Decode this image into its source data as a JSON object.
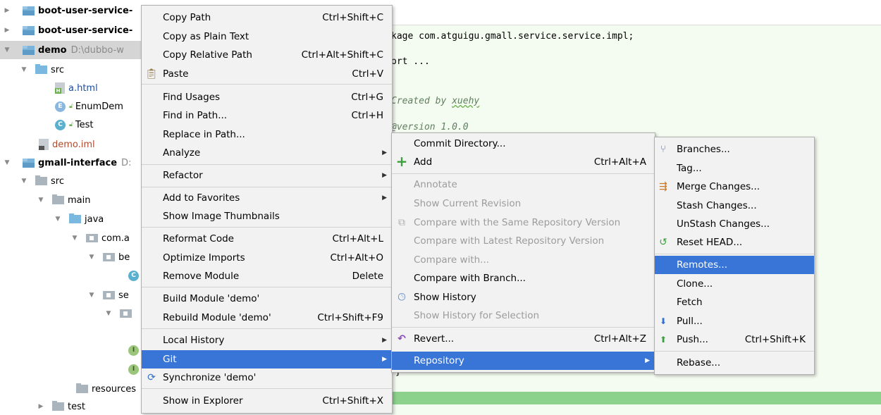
{
  "tree": {
    "items": [
      {
        "label": "boot-user-service-",
        "path": ""
      },
      {
        "label": "boot-user-service-",
        "path": ""
      },
      {
        "label": "demo",
        "path": "D:\\dubbo-w"
      },
      {
        "label": "src"
      },
      {
        "label": "a.html"
      },
      {
        "label": "EnumDem"
      },
      {
        "label": "Test"
      },
      {
        "label": "demo.iml"
      },
      {
        "label": "gmall-interface",
        "path": "D:"
      },
      {
        "label": "src"
      },
      {
        "label": "main"
      },
      {
        "label": "java"
      },
      {
        "label": "com.a"
      },
      {
        "label": "be"
      },
      {
        "label": "se"
      },
      {
        "label": "resources"
      },
      {
        "label": "test"
      }
    ],
    "icon_letters": {
      "enum": "E",
      "class": "C",
      "interface": "I"
    }
  },
  "editor": {
    "lines": [
      "kage com.atguigu.gmall.service.service.impl;",
      "ort ...",
      "Created by ",
      "xuehy",
      "@version 1.0.0",
      "}"
    ]
  },
  "context_menu": {
    "items": [
      {
        "label": "Copy Path",
        "shortcut": "Ctrl+Shift+C"
      },
      {
        "label": "Copy as Plain Text",
        "shortcut": ""
      },
      {
        "label": "Copy Relative Path",
        "shortcut": "Ctrl+Alt+Shift+C"
      },
      {
        "label": "Paste",
        "shortcut": "Ctrl+V"
      },
      {
        "label": "Find Usages",
        "shortcut": "Ctrl+G"
      },
      {
        "label": "Find in Path...",
        "shortcut": "Ctrl+H"
      },
      {
        "label": "Replace in Path...",
        "shortcut": ""
      },
      {
        "label": "Analyze",
        "shortcut": ""
      },
      {
        "label": "Refactor",
        "shortcut": ""
      },
      {
        "label": "Add to Favorites",
        "shortcut": ""
      },
      {
        "label": "Show Image Thumbnails",
        "shortcut": ""
      },
      {
        "label": "Reformat Code",
        "shortcut": "Ctrl+Alt+L"
      },
      {
        "label": "Optimize Imports",
        "shortcut": "Ctrl+Alt+O"
      },
      {
        "label": "Remove Module",
        "shortcut": "Delete"
      },
      {
        "label": "Build Module 'demo'",
        "shortcut": ""
      },
      {
        "label": "Rebuild Module 'demo'",
        "shortcut": "Ctrl+Shift+F9"
      },
      {
        "label": "Local History",
        "shortcut": ""
      },
      {
        "label": "Git",
        "shortcut": ""
      },
      {
        "label": "Synchronize 'demo'",
        "shortcut": ""
      },
      {
        "label": "Show in Explorer",
        "shortcut": "Ctrl+Shift+X"
      }
    ]
  },
  "git_menu": {
    "items": [
      {
        "label": "Commit Directory...",
        "shortcut": ""
      },
      {
        "label": "Add",
        "shortcut": "Ctrl+Alt+A"
      },
      {
        "label": "Annotate",
        "shortcut": ""
      },
      {
        "label": "Show Current Revision",
        "shortcut": ""
      },
      {
        "label": "Compare with the Same Repository Version",
        "shortcut": ""
      },
      {
        "label": "Compare with Latest Repository Version",
        "shortcut": ""
      },
      {
        "label": "Compare with...",
        "shortcut": ""
      },
      {
        "label": "Compare with Branch...",
        "shortcut": ""
      },
      {
        "label": "Show History",
        "shortcut": ""
      },
      {
        "label": "Show History for Selection",
        "shortcut": ""
      },
      {
        "label": "Revert...",
        "shortcut": "Ctrl+Alt+Z"
      },
      {
        "label": "Repository",
        "shortcut": ""
      }
    ]
  },
  "repo_menu": {
    "items": [
      {
        "label": "Branches...",
        "shortcut": ""
      },
      {
        "label": "Tag...",
        "shortcut": ""
      },
      {
        "label": "Merge Changes...",
        "shortcut": ""
      },
      {
        "label": "Stash Changes...",
        "shortcut": ""
      },
      {
        "label": "UnStash Changes...",
        "shortcut": ""
      },
      {
        "label": "Reset HEAD...",
        "shortcut": ""
      },
      {
        "label": "Remotes...",
        "shortcut": ""
      },
      {
        "label": "Clone...",
        "shortcut": ""
      },
      {
        "label": "Fetch",
        "shortcut": ""
      },
      {
        "label": "Pull...",
        "shortcut": ""
      },
      {
        "label": "Push...",
        "shortcut": "Ctrl+Shift+K"
      },
      {
        "label": "Rebase...",
        "shortcut": ""
      }
    ]
  },
  "colors": {
    "highlight": "#3875d7",
    "menu_bg": "#f2f2f2",
    "editor_bg": "#f4fbf0",
    "disabled_text": "#9c9c9c",
    "add_green": "#3c9f3c",
    "revert_purple": "#8a4cb4"
  }
}
